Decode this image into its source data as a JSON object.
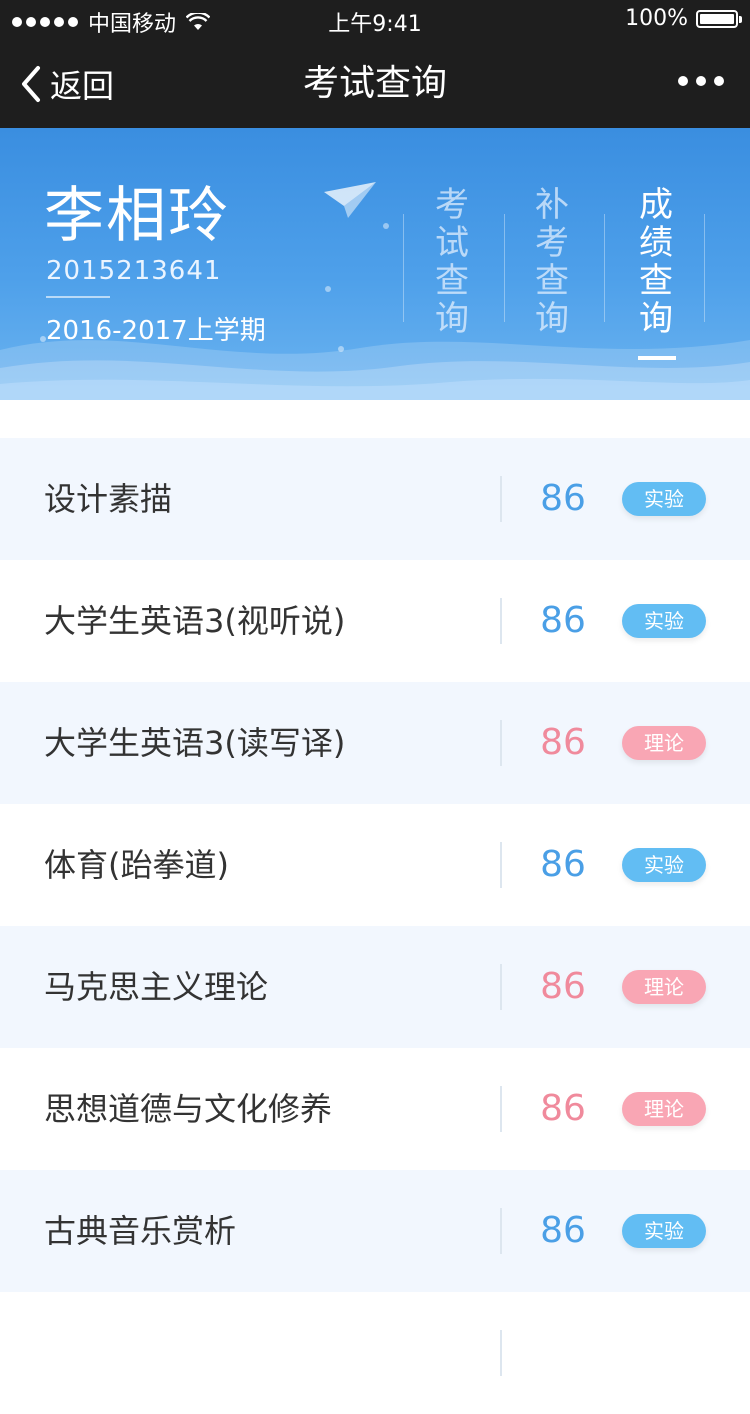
{
  "status_bar": {
    "carrier": "中国移动",
    "time": "上午9:41",
    "battery": "100%",
    "battery_level": 1.0
  },
  "nav": {
    "back_label": "返回",
    "title": "考试查询"
  },
  "student": {
    "name": "李相玲",
    "id": "2015213641",
    "semester": "2016-2017上学期"
  },
  "tabs": [
    {
      "label": "考试查询",
      "active": false
    },
    {
      "label": "补考查询",
      "active": false
    },
    {
      "label": "成绩查询",
      "active": true
    }
  ],
  "colors": {
    "accent_blue": "#4a9fe6",
    "score_pink": "#f08a9c",
    "tag_blue": "#62bdf3",
    "tag_pink": "#f9a6b4",
    "header_start": "#3a8ee0",
    "header_end": "#6cb4f0"
  },
  "grades": [
    {
      "course": "设计素描",
      "score": "86",
      "type": "实验"
    },
    {
      "course": "大学生英语3(视听说)",
      "score": "86",
      "type": "实验"
    },
    {
      "course": "大学生英语3(读写译)",
      "score": "86",
      "type": "理论"
    },
    {
      "course": "体育(跆拳道)",
      "score": "86",
      "type": "实验"
    },
    {
      "course": "马克思主义理论",
      "score": "86",
      "type": "理论"
    },
    {
      "course": "思想道德与文化修养",
      "score": "86",
      "type": "理论"
    },
    {
      "course": "古典音乐赏析",
      "score": "86",
      "type": "实验"
    }
  ]
}
